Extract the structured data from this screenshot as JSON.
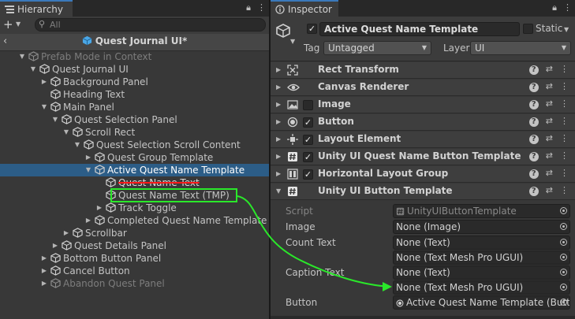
{
  "hierarchy": {
    "tab_label": "Hierarchy",
    "search_placeholder": "All",
    "prefab_title": "Quest Journal UI*",
    "tree": [
      {
        "label": "Prefab Mode in Context",
        "depth": 0,
        "expanded": true,
        "dim": true
      },
      {
        "label": "Quest Journal UI",
        "depth": 1,
        "expanded": true
      },
      {
        "label": "Background Panel",
        "depth": 2,
        "expanded": false
      },
      {
        "label": "Heading Text",
        "depth": 2,
        "leaf": true
      },
      {
        "label": "Main Panel",
        "depth": 2,
        "expanded": true
      },
      {
        "label": "Quest Selection Panel",
        "depth": 3,
        "expanded": true
      },
      {
        "label": "Scroll Rect",
        "depth": 4,
        "expanded": true
      },
      {
        "label": "Quest Selection Scroll Content",
        "depth": 5,
        "expanded": true
      },
      {
        "label": "Quest Group Template",
        "depth": 6,
        "expanded": false
      },
      {
        "label": "Active Quest Name Template",
        "depth": 6,
        "expanded": true,
        "selected": true
      },
      {
        "label": "Quest Name Text",
        "depth": 7,
        "leaf": true,
        "strike": true
      },
      {
        "label": "Quest Name Text (TMP)",
        "depth": 7,
        "leaf": true,
        "highlight": true
      },
      {
        "label": "Track Toggle",
        "depth": 7,
        "expanded": false
      },
      {
        "label": "Completed Quest Name Template",
        "depth": 6,
        "expanded": false
      },
      {
        "label": "Scrollbar",
        "depth": 4,
        "expanded": false
      },
      {
        "label": "Quest Details Panel",
        "depth": 3,
        "expanded": false
      },
      {
        "label": "Bottom Button Panel",
        "depth": 2,
        "expanded": false
      },
      {
        "label": "Cancel Button",
        "depth": 2,
        "expanded": false
      },
      {
        "label": "Abandon Quest Panel",
        "depth": 2,
        "expanded": false,
        "dim": true
      }
    ]
  },
  "inspector": {
    "tab_label": "Inspector",
    "object_name": "Active Quest Name Template",
    "static_label": "Static",
    "tag_label": "Tag",
    "tag_value": "Untagged",
    "layer_label": "Layer",
    "layer_value": "UI",
    "components": [
      {
        "name": "Rect Transform",
        "icon": "rect-transform-icon",
        "checkbox": false
      },
      {
        "name": "Canvas Renderer",
        "icon": "eye-icon",
        "checkbox": false
      },
      {
        "name": "Image",
        "icon": "image-icon",
        "checkbox": "off"
      },
      {
        "name": "Button",
        "icon": "button-icon",
        "checkbox": "on"
      },
      {
        "name": "Layout Element",
        "icon": "layout-element-icon",
        "checkbox": "on"
      },
      {
        "name": "Unity UI Quest Name Button Template",
        "icon": "script-icon",
        "checkbox": "on"
      },
      {
        "name": "Horizontal Layout Group",
        "icon": "horizontal-layout-icon",
        "checkbox": "on"
      },
      {
        "name": "Unity UI Button Template",
        "icon": "script-icon",
        "checkbox": false,
        "expanded": true
      }
    ],
    "fields": [
      {
        "label": "Script",
        "values": [
          "UnityUIButtonTemplate"
        ],
        "dim": true,
        "icon": "script-icon"
      },
      {
        "label": "Image",
        "values": [
          "None (Image)"
        ]
      },
      {
        "label": "Count Text",
        "values": [
          "None (Text)",
          "None (Text Mesh Pro UGUI)"
        ]
      },
      {
        "label": "Caption Text",
        "values": [
          "None (Text)",
          "None (Text Mesh Pro UGUI)"
        ]
      },
      {
        "label": "Button",
        "values": [
          "Active Quest Name Template (Butt"
        ],
        "icon": "button-icon"
      }
    ]
  },
  "colors": {
    "selection": "#2c5d87",
    "highlight_box": "#2ae82a",
    "strike": "#ff1a1a",
    "accent_tab": "#3a79bb"
  }
}
